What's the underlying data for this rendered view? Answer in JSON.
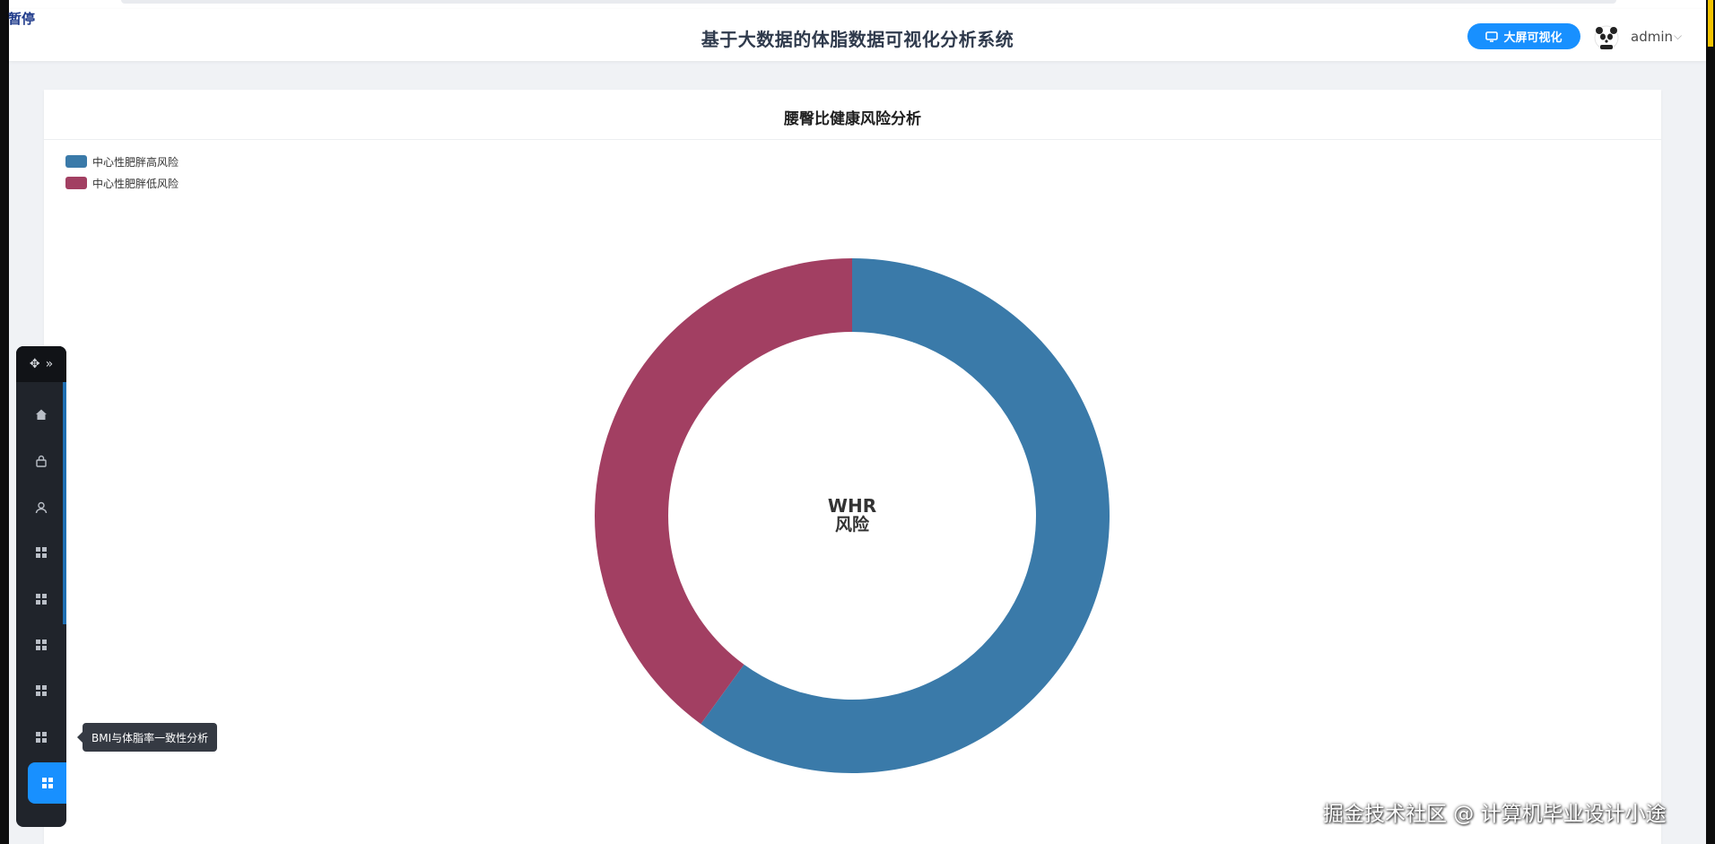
{
  "overlay": {
    "paused_label": "暂停"
  },
  "header": {
    "title": "基于大数据的体脂数据可视化分析系统",
    "big_screen_label": "大屏可视化",
    "user_name": "admin",
    "accent_color": "#1890ff"
  },
  "card": {
    "title": "腰臀比健康风险分析"
  },
  "chart_data": {
    "type": "pie",
    "subtype": "donut",
    "center_label_line1": "WHR",
    "center_label_line2": "风险",
    "legend_position": "top-left",
    "series": [
      {
        "name": "中心性肥胖高风险",
        "value": 60,
        "color": "#3a7aa9"
      },
      {
        "name": "中心性肥胖低风险",
        "value": 40,
        "color": "#a23f62"
      }
    ]
  },
  "dock": {
    "items": [
      {
        "icon": "home-icon"
      },
      {
        "icon": "lock-icon"
      },
      {
        "icon": "user-icon"
      },
      {
        "icon": "grid-icon"
      },
      {
        "icon": "grid-icon"
      },
      {
        "icon": "grid-icon"
      },
      {
        "icon": "grid-icon"
      },
      {
        "icon": "grid-icon"
      },
      {
        "icon": "grid-icon"
      }
    ],
    "tooltip": "BMI与体脂率一致性分析"
  },
  "watermark": "掘金技术社区 @ 计算机毕业设计小途"
}
